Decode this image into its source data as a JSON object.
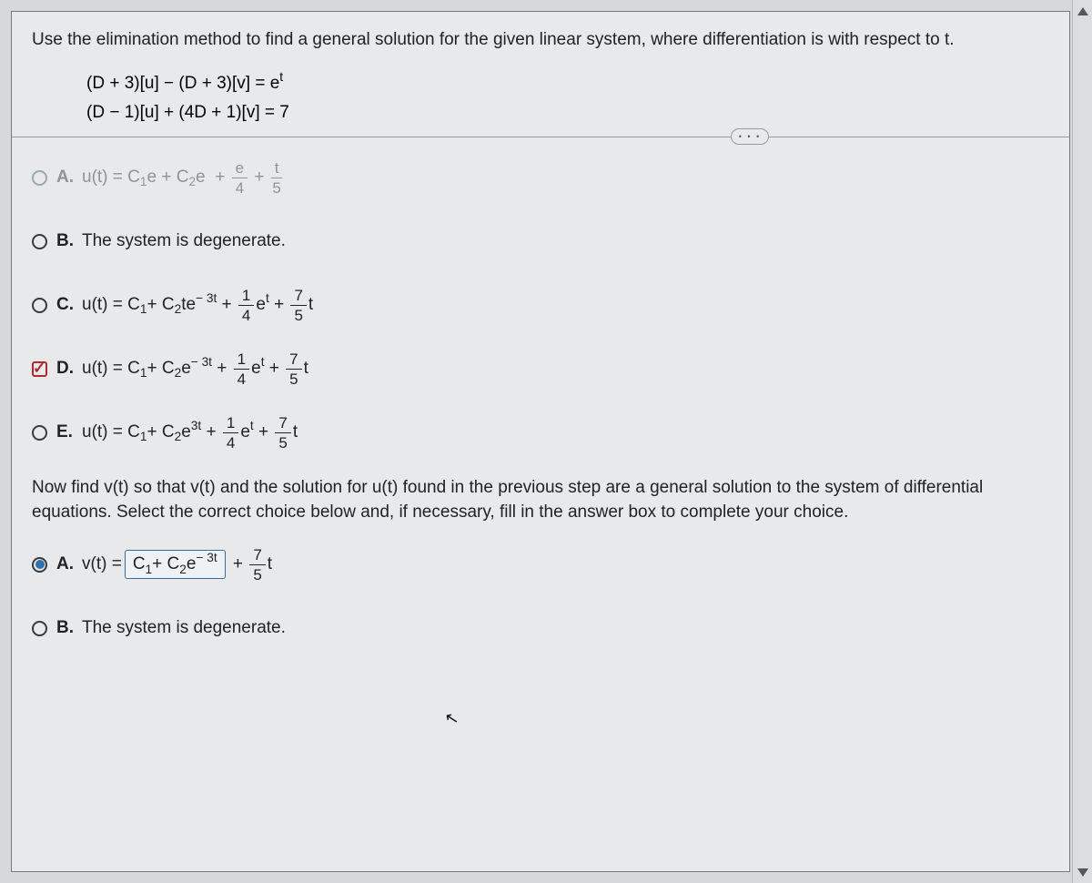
{
  "question": {
    "intro": "Use the elimination method to find a general solution for the given linear system, where differentiation is with respect to t.",
    "eq1_lhs": "(D + 3)[u] − (D + 3)[v]",
    "eq1_rhs_base": "e",
    "eq1_rhs_sup": "t",
    "eq2_lhs": "(D − 1)[u] + (4D + 1)[v]",
    "eq2_rhs": "7"
  },
  "more": "• • •",
  "part1": {
    "A": {
      "label": "A.",
      "lead": "u(t) = C",
      "sub1": "1",
      "mid": "e + C",
      "sub2": "2",
      "tail": "e",
      "plus1": "+",
      "f1n": "e",
      "f1d": "4",
      "plus2": "+",
      "f2n": "t",
      "f2d": "5"
    },
    "B": {
      "label": "B.",
      "text": "The system is degenerate."
    },
    "C": {
      "label": "C.",
      "lead": "u(t) = C",
      "sub1": "1",
      "mid": " + C",
      "sub2": "2",
      "te": "te",
      "exp": "− 3t",
      "plus1": "+",
      "f1n": "1",
      "f1d": "4",
      "et_base": "e",
      "et_sup": "t",
      "plus2": "+",
      "f2n": "7",
      "f2d": "5",
      "t": "t"
    },
    "D": {
      "label": "D.",
      "lead": "u(t) = C",
      "sub1": "1",
      "mid": " + C",
      "sub2": "2",
      "e": "e",
      "exp": "− 3t",
      "plus1": "+",
      "f1n": "1",
      "f1d": "4",
      "et_base": "e",
      "et_sup": "t",
      "plus2": "+",
      "f2n": "7",
      "f2d": "5",
      "t": "t"
    },
    "E": {
      "label": "E.",
      "lead": "u(t) = C",
      "sub1": "1",
      "mid": " + C",
      "sub2": "2",
      "e": "e",
      "exp": "3t",
      "plus1": "+",
      "f1n": "1",
      "f1d": "4",
      "et_base": "e",
      "et_sup": "t",
      "plus2": "+",
      "f2n": "7",
      "f2d": "5",
      "t": "t"
    }
  },
  "part2": {
    "intro": "Now find v(t) so that v(t) and the solution for u(t) found in the previous step are a general solution to the system of differential equations. Select the correct choice below and, if necessary, fill in the answer box to complete your choice.",
    "A": {
      "label": "A.",
      "pre": "v(t) = ",
      "box_lead": "C",
      "box_sub1": "1",
      "box_mid": " + C",
      "box_sub2": "2",
      "box_e": "e",
      "box_exp": "− 3t",
      "plus": "+",
      "fn": "7",
      "fd": "5",
      "t": "t"
    },
    "B": {
      "label": "B.",
      "text": "The system is degenerate."
    }
  }
}
